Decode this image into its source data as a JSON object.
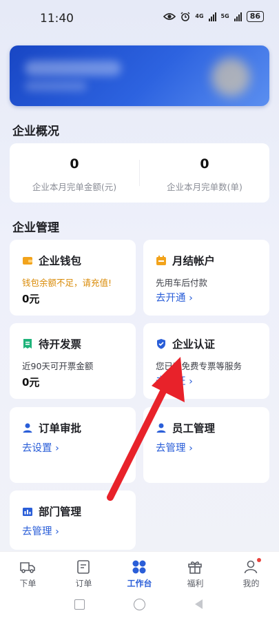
{
  "status_bar": {
    "time": "11:40",
    "net1": "4G",
    "net2": "5G",
    "battery": "86"
  },
  "overview": {
    "title": "企业概况",
    "items": [
      {
        "value": "0",
        "label": "企业本月完单金额(元)"
      },
      {
        "value": "0",
        "label": "企业本月完单数(单)"
      }
    ]
  },
  "management": {
    "title": "企业管理",
    "wallet": {
      "title": "企业钱包",
      "subtitle": "钱包余额不足，请充值!",
      "value": "0元",
      "icon": "wallet-icon"
    },
    "monthly": {
      "title": "月结帐户",
      "subtitle": "先用车后付款",
      "link": "去开通 ›",
      "icon": "calendar-icon"
    },
    "invoice": {
      "title": "待开发票",
      "subtitle": "近90天可开票金额",
      "value": "0元",
      "icon": "receipt-icon"
    },
    "certification": {
      "title": "企业认证",
      "subtitle": "您已获免费专票等服务",
      "link": "去认证 ›",
      "icon": "shield-icon"
    },
    "approval": {
      "title": "订单审批",
      "link": "去设置 ›",
      "icon": "user-approve-icon"
    },
    "staff": {
      "title": "员工管理",
      "link": "去管理 ›",
      "icon": "user-icon"
    },
    "department": {
      "title": "部门管理",
      "link": "去管理 ›",
      "icon": "department-icon"
    }
  },
  "tabbar": {
    "items": [
      {
        "label": "下单",
        "icon": "truck-icon"
      },
      {
        "label": "订单",
        "icon": "order-icon"
      },
      {
        "label": "工作台",
        "icon": "workbench-icon",
        "active": true
      },
      {
        "label": "福利",
        "icon": "gift-icon"
      },
      {
        "label": "我的",
        "icon": "profile-icon",
        "badge": "dot"
      }
    ]
  },
  "colors": {
    "accent": "#2a5ed8",
    "warning": "#d98a06",
    "annotation_arrow": "#e8222a"
  }
}
